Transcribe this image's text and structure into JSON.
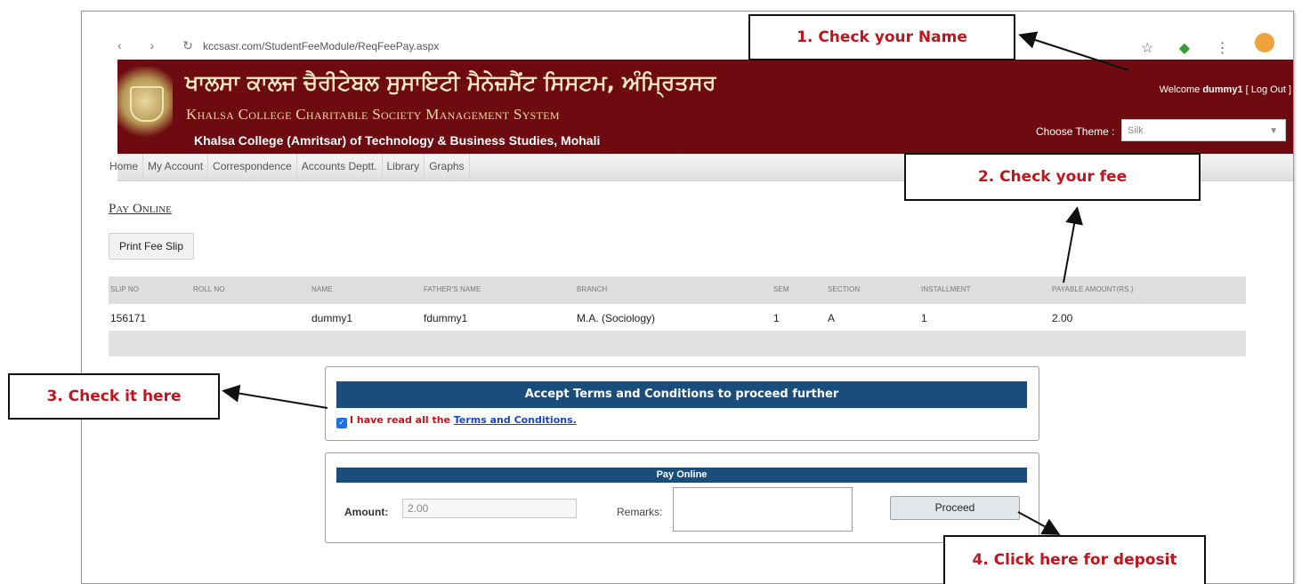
{
  "browser": {
    "url": "kccsasr.com/StudentFeeModule/ReqFeePay.aspx",
    "nav_glyphs": "‹ › ↻",
    "icons": [
      "bookmark-icon",
      "extension-icon",
      "menu-icon",
      "profile-avatar"
    ]
  },
  "banner": {
    "title_punjabi": "ਖਾਲਸਾ ਕਾਲਜ ਚੈਰੀਟੇਬਲ ਸੁਸਾਇਟੀ ਮੈਨੇਜ਼ਮੈਂਟ ਸਿਸਟਮ, ਅੰਮ੍ਰਿਤਸਰ",
    "title_english": "Khalsa College Charitable Society Management System",
    "subtitle": "Khalsa College (Amritsar) of Technology & Business Studies, Mohali",
    "welcome_prefix": "Welcome",
    "username": "dummy1",
    "logout": "[ Log Out ]",
    "theme_label": "Choose Theme :",
    "theme_value": "Silk"
  },
  "menu": {
    "items": [
      "Home",
      "My Account",
      "Correspondence",
      "Accounts Deptt.",
      "Library",
      "Graphs"
    ]
  },
  "page": {
    "title": "Pay Online",
    "print_button": "Print Fee Slip"
  },
  "table": {
    "headers": [
      "SLIP NO",
      "ROLL NO",
      "NAME",
      "FATHER'S NAME",
      "BRANCH",
      "SEM",
      "SECTION",
      "INSTALLMENT",
      "PAYABLE AMOUNT(RS.)"
    ],
    "row": {
      "slip_no": "156171",
      "roll_no": "",
      "name": "dummy1",
      "fathers_name": "fdummy1",
      "branch": "M.A. (Sociology)",
      "sem": "1",
      "section": "A",
      "installment": "1",
      "payable_amount": "2.00"
    }
  },
  "terms": {
    "header": "Accept Terms and Conditions to proceed further",
    "checked": true,
    "text": "I have read all the",
    "link": "Terms and Conditions."
  },
  "pay": {
    "header": "Pay Online",
    "amount_label": "Amount:",
    "amount_value": "2.00",
    "remarks_label": "Remarks:",
    "remarks_value": "",
    "proceed": "Proceed"
  },
  "callouts": {
    "c1": "1. Check your Name",
    "c2": "2. Check your fee",
    "c3": "3. Check it here",
    "c4": "4. Click here for deposit"
  },
  "colors": {
    "banner": "#6e0b10",
    "panel_header": "#1b4d7b",
    "callout_text": "#c0151d"
  }
}
